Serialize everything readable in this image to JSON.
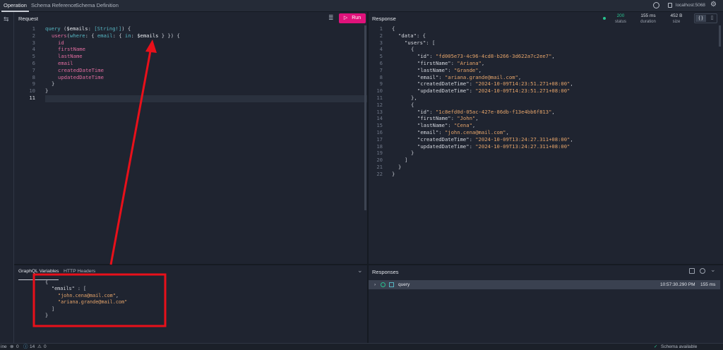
{
  "topbar": {
    "tabs": [
      "Operation",
      "Schema Reference",
      "Schema Definition"
    ],
    "server": "localhost:5068"
  },
  "request": {
    "title": "Request",
    "run_label": "Run",
    "lines": [
      {
        "n": "1"
      },
      {
        "n": "2"
      },
      {
        "n": "3"
      },
      {
        "n": "4"
      },
      {
        "n": "5"
      },
      {
        "n": "6"
      },
      {
        "n": "7"
      },
      {
        "n": "8"
      },
      {
        "n": "9"
      },
      {
        "n": "10"
      },
      {
        "n": "11"
      }
    ],
    "code": {
      "l1_kw": "query",
      "l1_a": " (",
      "l1_var": "$emails",
      "l1_b": ": ",
      "l1_type": "[String!]",
      "l1_c": ") {",
      "l2_fn": "users",
      "l2_a": "(",
      "l2_where": "where",
      "l2_b": ": { ",
      "l2_email": "email",
      "l2_c": ": { ",
      "l2_in": "in",
      "l2_d": ": ",
      "l2_var": "$emails",
      "l2_e": " } }) {",
      "f1": "id",
      "f2": "firstName",
      "f3": "lastName",
      "f4": "email",
      "f5": "createdDateTime",
      "f6": "updatedDateTime",
      "close_inner": "}",
      "close_outer": "}"
    }
  },
  "response": {
    "title": "Response",
    "status_value": "200",
    "status_label": "status",
    "duration_value": "155 ms",
    "duration_label": "duration",
    "size_value": "452 B",
    "size_label": "size",
    "lines": [
      "1",
      "2",
      "3",
      "4",
      "5",
      "6",
      "7",
      "8",
      "9",
      "10",
      "11",
      "12",
      "13",
      "14",
      "15",
      "16",
      "17",
      "18",
      "19",
      "20",
      "21",
      "22"
    ],
    "json": {
      "data_key": "\"data\"",
      "users_key": "\"users\"",
      "id_key": "\"id\"",
      "firstName_key": "\"firstName\"",
      "lastName_key": "\"lastName\"",
      "email_key": "\"email\"",
      "created_key": "\"createdDateTime\"",
      "updated_key": "\"updatedDateTime\"",
      "u1_id": "\"fd005e73-4c96-4cd8-b266-3d622a7c2ee7\"",
      "u1_first": "\"Ariana\"",
      "u1_last": "\"Grande\"",
      "u1_email": "\"ariana.grande@mail.com\"",
      "u1_created": "\"2024-10-09T14:23:51.271+08:00\"",
      "u1_updated": "\"2024-10-09T14:23:51.271+08:00\"",
      "u2_id": "\"1c8efd0d-05ac-427e-86db-f13e4bb6f813\"",
      "u2_first": "\"John\"",
      "u2_last": "\"Cena\"",
      "u2_email": "\"john.cena@mail.com\"",
      "u2_created": "\"2024-10-09T13:24:27.311+08:00\"",
      "u2_updated": "\"2024-10-09T13:24:27.311+08:00\""
    }
  },
  "variables": {
    "tab_vars": "GraphQL Variables",
    "tab_headers": "HTTP Headers",
    "emails_key": "\"emails\"",
    "email1": "\"john.cena@mail.com\"",
    "email2": "\"ariana.grande@mail.com\""
  },
  "responses": {
    "title": "Responses",
    "item_label": "query",
    "item_time": "10:57:30.290 PM",
    "item_duration": "155 ms"
  },
  "statusbar": {
    "left_text": "ine",
    "errors": "0",
    "warnings": "14",
    "infos": "0",
    "schema": "Schema available"
  },
  "colors": {
    "accent": "#e0127b",
    "annotation": "#e8101a",
    "status_ok": "#27c28e"
  }
}
